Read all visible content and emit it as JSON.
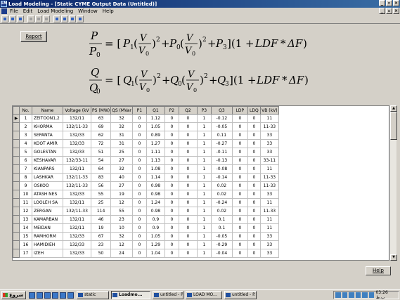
{
  "window": {
    "title": "Load Modeling - [Static CYME Output Data (Untitled)]",
    "app_icon": "LM"
  },
  "menu": [
    "File",
    "Edit",
    "Load Modeling",
    "Window",
    "Help"
  ],
  "report_label": "Report",
  "help_label": "Help",
  "formula": {
    "P": "P",
    "P0": "P",
    "Q": "Q",
    "Q0": "Q",
    "V": "V",
    "V0": "V",
    "zero": "0",
    "LDF": "LDF",
    "dF": "ΔF"
  },
  "table": {
    "columns": [
      "No.",
      "Name",
      "Voltage (kV",
      "PS (MW)",
      "QS (MVar",
      "P1",
      "Q1",
      "P2",
      "Q2",
      "P3",
      "Q3",
      "LDP",
      "LDQ",
      "VB (kV)"
    ],
    "rows": [
      [
        "1",
        "ZEITOON1,2",
        "132/11",
        "63",
        "32",
        "0",
        "1.12",
        "0",
        "0",
        "1",
        "-0.12",
        "0",
        "0",
        "11"
      ],
      [
        "2",
        "KHORMA",
        "132/11-33",
        "69",
        "32",
        "0",
        "1.05",
        "0",
        "0",
        "1",
        "-0.05",
        "0",
        "0",
        "11-33"
      ],
      [
        "3",
        "SEPANTA",
        "132/33",
        "62",
        "31",
        "0",
        "0.89",
        "0",
        "0",
        "1",
        "0.11",
        "0",
        "0",
        "33"
      ],
      [
        "4",
        "KOOT AMIR",
        "132/33",
        "72",
        "31",
        "0",
        "1.27",
        "0",
        "0",
        "1",
        "-0.27",
        "0",
        "0",
        "33"
      ],
      [
        "5",
        "GOLESTAN",
        "132/33",
        "51",
        "25",
        "0",
        "1.11",
        "0",
        "0",
        "1",
        "-0.11",
        "0",
        "0",
        "33"
      ],
      [
        "6",
        "KESHAVAR",
        "132/33-11",
        "54",
        "27",
        "0",
        "1.13",
        "0",
        "0",
        "1",
        "-0.13",
        "0",
        "0",
        "33-11"
      ],
      [
        "7",
        "KIANPARS",
        "132/11",
        "64",
        "32",
        "0",
        "1.08",
        "0",
        "0",
        "1",
        "-0.08",
        "0",
        "0",
        "11"
      ],
      [
        "8",
        "LASHKAR",
        "132/11-33",
        "83",
        "40",
        "0",
        "1.14",
        "0",
        "0",
        "1",
        "-0.14",
        "0",
        "0",
        "11-33"
      ],
      [
        "9",
        "OSKOO",
        "132/11-33",
        "56",
        "27",
        "0",
        "0.98",
        "0",
        "0",
        "1",
        "0.02",
        "0",
        "0",
        "11-33"
      ],
      [
        "10",
        "ATASH NES",
        "132/33",
        "55",
        "19",
        "0",
        "0.98",
        "0",
        "0",
        "1",
        "0.02",
        "0",
        "0",
        "33"
      ],
      [
        "11",
        "LOOLEH SA",
        "132/11",
        "25",
        "12",
        "0",
        "1.24",
        "0",
        "0",
        "1",
        "-0.24",
        "0",
        "0",
        "11"
      ],
      [
        "12",
        "ZERGAN",
        "132/11-33",
        "114",
        "55",
        "0",
        "0.98",
        "0",
        "0",
        "1",
        "0.02",
        "0",
        "0",
        "11-33"
      ],
      [
        "13",
        "KAMARBAN",
        "132/11",
        "46",
        "23",
        "0",
        "0.9",
        "0",
        "0",
        "1",
        "0.1",
        "0",
        "0",
        "11"
      ],
      [
        "14",
        "MEIDAN",
        "132/11",
        "19",
        "10",
        "0",
        "0.9",
        "0",
        "0",
        "1",
        "0.1",
        "0",
        "0",
        "11"
      ],
      [
        "15",
        "RAMHORM",
        "132/33",
        "67",
        "32",
        "0",
        "1.05",
        "0",
        "0",
        "1",
        "-0.05",
        "0",
        "0",
        "33"
      ],
      [
        "16",
        "HAMIDIEH",
        "132/33",
        "23",
        "12",
        "0",
        "1.29",
        "0",
        "0",
        "1",
        "-0.29",
        "0",
        "0",
        "33"
      ],
      [
        "17",
        "IZEH",
        "132/33",
        "50",
        "24",
        "0",
        "1.04",
        "0",
        "0",
        "1",
        "-0.04",
        "0",
        "0",
        "33"
      ]
    ]
  },
  "taskbar": {
    "start_label": "شروع",
    "tasks": [
      "static",
      "Loadmo...",
      "untitled - P...",
      "LOAD MO...",
      "untitled - P..."
    ],
    "clock": "03:26 ب.ظ"
  }
}
